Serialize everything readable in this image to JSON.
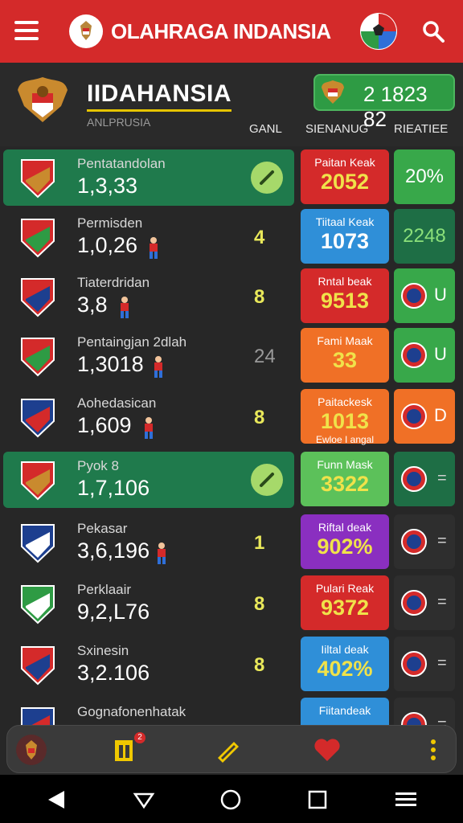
{
  "app": {
    "title": "OLAHRAGA INDANSIA"
  },
  "header": {
    "team_title": "IIDAHANSIA",
    "team_subtitle": "ANLPRUSIA",
    "score": "2 1823  82",
    "columns": [
      "GANL",
      "SIENANUG",
      "RIEATIEE"
    ]
  },
  "rows": [
    {
      "name": "Pentatandolan",
      "value": "1,3,33",
      "highlight": true,
      "stat_small": "",
      "box_label": "Paitan Keak",
      "box_value": "2052",
      "box_sub": "",
      "box_color": "#d42a2a",
      "rel_text": "20%",
      "rel_color": "#38a84a"
    },
    {
      "name": "Permisden",
      "value": "1,0,26",
      "highlight": false,
      "stat_small": "4",
      "box_label": "Tiitaal Keak",
      "box_value": "1073",
      "box_sub": "",
      "box_color": "#2f8fd8",
      "rel_text": "2248",
      "rel_color": "#1e6e45"
    },
    {
      "name": "Tiaterdridan",
      "value": "3,8",
      "highlight": false,
      "stat_small": "8",
      "box_label": "Rntal beak",
      "box_value": "9513",
      "box_sub": "",
      "box_color": "#d42a2a",
      "rel_text": "U",
      "rel_color": "#38a84a"
    },
    {
      "name": "Pentaingjan 2dlah",
      "value": "1,3018",
      "highlight": false,
      "stat_small": "24",
      "box_label": "Fami Maak",
      "box_value": "33",
      "box_sub": "",
      "box_color": "#f07026",
      "rel_text": "U",
      "rel_color": "#38a84a"
    },
    {
      "name": "Aohedasican",
      "value": "1,609",
      "highlight": false,
      "stat_small": "8",
      "box_label": "Paitackesk",
      "box_value": "1013",
      "box_sub": "Ewloe I angal",
      "box_color": "#f07026",
      "rel_text": "D",
      "rel_color": "#f07026"
    },
    {
      "name": "Pyok 8",
      "value": "1,7,106",
      "highlight": true,
      "stat_small": "",
      "box_label": "Funn Mask",
      "box_value": "3322",
      "box_sub": "",
      "box_color": "#5cc15a",
      "rel_text": "=",
      "rel_color": "#1e6e45"
    },
    {
      "name": "Pekasar",
      "value": "3,6,196",
      "highlight": false,
      "stat_small": "1",
      "box_label": "Riftal deak",
      "box_value": "902%",
      "box_sub": "",
      "box_color": "#8a2fc0",
      "rel_text": "=",
      "rel_color": "#2e2e2e"
    },
    {
      "name": "Perklaair",
      "value": "9,2,L76",
      "highlight": false,
      "stat_small": "8",
      "box_label": "Pulari Reak",
      "box_value": "9372",
      "box_sub": "",
      "box_color": "#d42a2a",
      "rel_text": "=",
      "rel_color": "#2e2e2e"
    },
    {
      "name": "Sxinesin",
      "value": "3,2.106",
      "highlight": false,
      "stat_small": "8",
      "box_label": "Iiltal deak",
      "box_value": "402%",
      "box_sub": "",
      "box_color": "#2f8fd8",
      "rel_text": "=",
      "rel_color": "#2e2e2e"
    },
    {
      "name": "Gognafonenhatak",
      "value": "",
      "highlight": false,
      "stat_small": "",
      "box_label": "Fiitandeak",
      "box_value": "",
      "box_sub": "",
      "box_color": "#2f8fd8",
      "rel_text": "=",
      "rel_color": "#2e2e2e"
    }
  ],
  "tabbar": {
    "notification_count": "2"
  },
  "colors": {
    "brand_red": "#d42a2a",
    "highlight_green": "#1f7a4c",
    "accent_yellow": "#e6c400"
  },
  "icons": [
    "menu-icon",
    "emblem-icon",
    "soccer-ball-icon",
    "search-icon",
    "home-icon",
    "trophy-icon",
    "pencil-icon",
    "heart-icon",
    "more-icon",
    "back-icon",
    "home-nav-icon",
    "recents-icon",
    "menu-nav-icon"
  ]
}
